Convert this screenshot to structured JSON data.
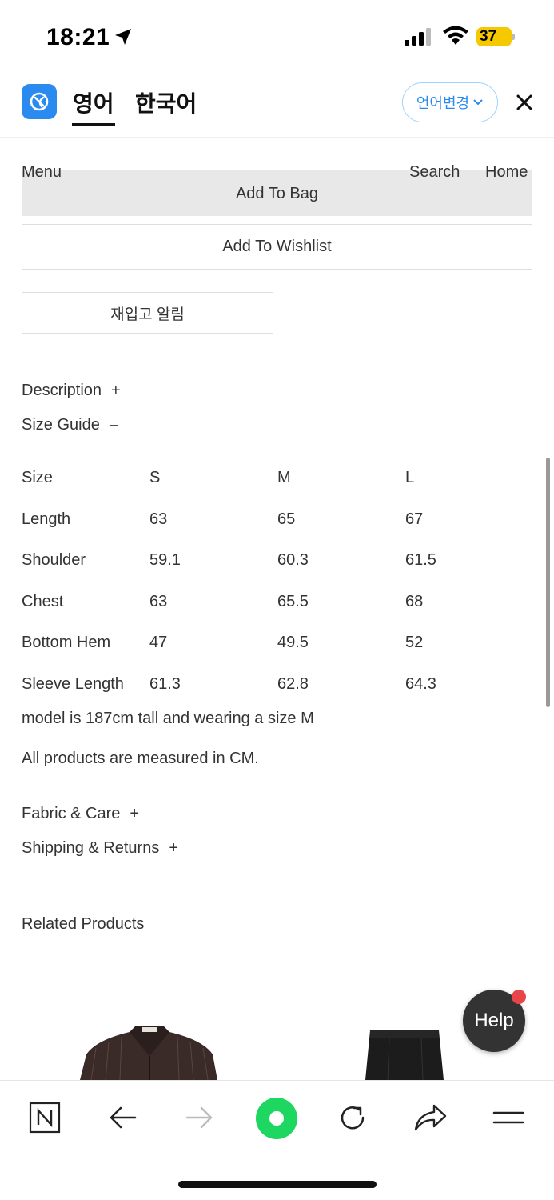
{
  "status_bar": {
    "time": "18:21",
    "battery": "37"
  },
  "translate_bar": {
    "tab_active": "영어",
    "tab_inactive": "한국어",
    "change_lang_label": "언어변경",
    "accent": "#2a8af0"
  },
  "nav": {
    "menu": "Menu",
    "search": "Search",
    "home": "Home"
  },
  "buttons": {
    "add_to_bag": "Add To Bag",
    "add_to_wishlist": "Add To Wishlist",
    "restock_alert": "재입고 알림"
  },
  "accordions": {
    "description": "Description",
    "description_sym": "+",
    "size_guide": "Size Guide",
    "size_guide_sym": "–",
    "fabric_care": "Fabric & Care",
    "fabric_care_sym": "+",
    "shipping_returns": "Shipping & Returns",
    "shipping_returns_sym": "+"
  },
  "size_table": {
    "rows": [
      [
        "Size",
        "S",
        "M",
        "L"
      ],
      [
        "Length",
        "63",
        "65",
        "67"
      ],
      [
        "Shoulder",
        "59.1",
        "60.3",
        "61.5"
      ],
      [
        "Chest",
        "63",
        "65.5",
        "68"
      ],
      [
        "Bottom Hem",
        "47",
        "49.5",
        "52"
      ],
      [
        "Sleeve Length",
        "61.3",
        "62.8",
        "64.3"
      ]
    ]
  },
  "notes": {
    "model": "model is 187cm tall and wearing a size M",
    "measure": "All products are measured in CM."
  },
  "related": {
    "title": "Related Products"
  },
  "help": {
    "label": "Help"
  }
}
